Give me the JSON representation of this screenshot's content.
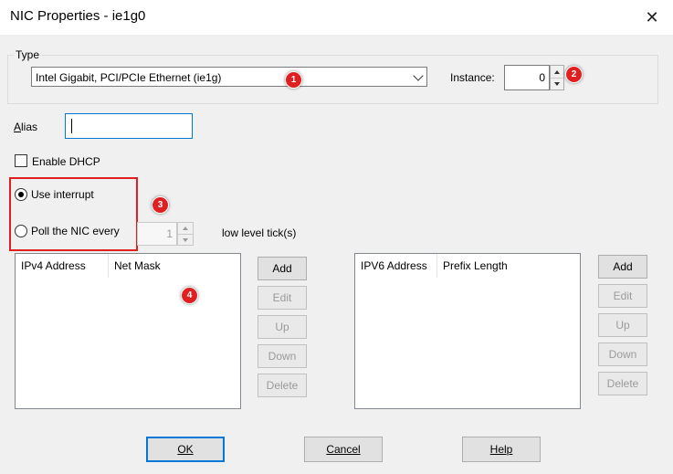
{
  "window": {
    "title": "NIC Properties - ie1g0"
  },
  "type_group": {
    "label": "Type",
    "nic_type": "Intel Gigabit, PCI/PCIe Ethernet (ie1g)",
    "instance_label": "Instance:",
    "instance_value": "0"
  },
  "alias": {
    "label": "Alias",
    "value": ""
  },
  "dhcp": {
    "label": "Enable DHCP",
    "checked": false
  },
  "mode": {
    "use_interrupt_label": "Use interrupt",
    "poll_label": "Poll the NIC every",
    "poll_value": "1",
    "tick_label": "low level tick(s)",
    "selected": "use_interrupt"
  },
  "ipv4": {
    "columns": [
      "IPv4 Address",
      "Net Mask"
    ],
    "rows": [],
    "buttons": {
      "add": "Add",
      "edit": "Edit",
      "up": "Up",
      "down": "Down",
      "delete": "Delete"
    }
  },
  "ipv6": {
    "columns": [
      "IPV6 Address",
      "Prefix Length"
    ],
    "rows": [],
    "buttons": {
      "add": "Add",
      "edit": "Edit",
      "up": "Up",
      "down": "Down",
      "delete": "Delete"
    }
  },
  "footer": {
    "ok": "OK",
    "cancel": "Cancel",
    "help": "Help"
  },
  "annotations": [
    "1",
    "2",
    "3",
    "4"
  ],
  "colors": {
    "annotation": "#e02020",
    "accent": "#0078d7"
  }
}
